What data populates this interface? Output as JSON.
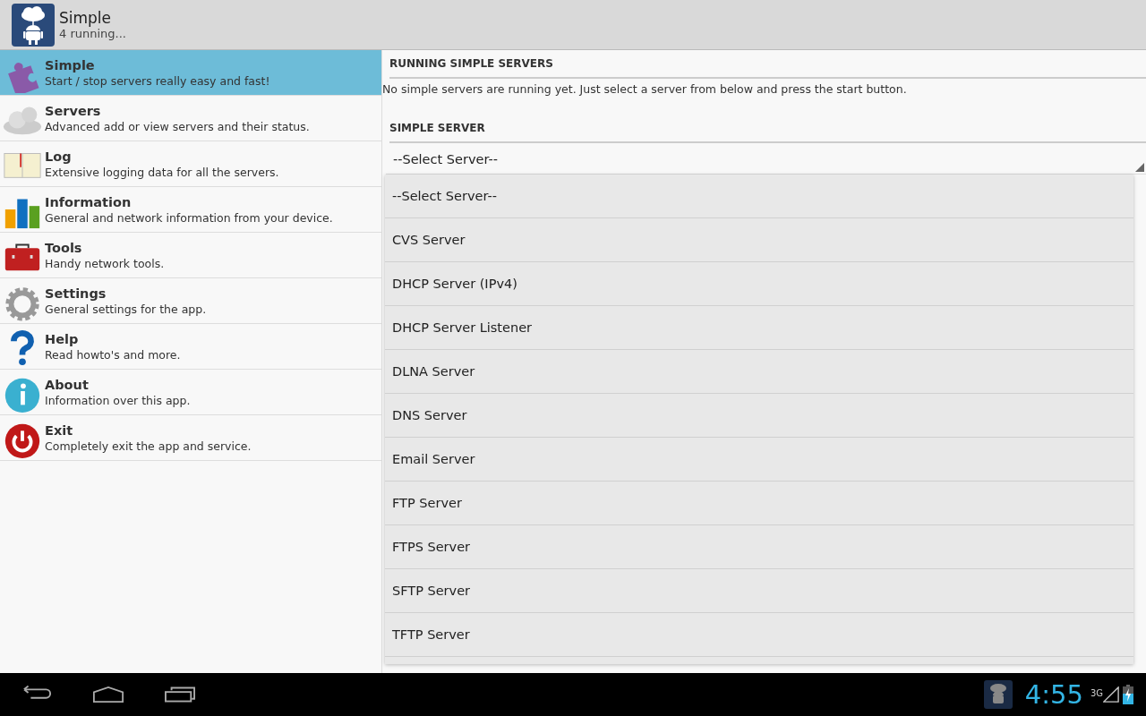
{
  "action_bar": {
    "title": "Simple",
    "subtitle": "4 running..."
  },
  "sidebar": {
    "items": [
      {
        "kind": "puzzle",
        "title": "Simple",
        "subtitle": "Start / stop servers really easy and fast!",
        "selected": true
      },
      {
        "kind": "cloud",
        "title": "Servers",
        "subtitle": "Advanced add or view servers and their status.",
        "selected": false
      },
      {
        "kind": "book",
        "title": "Log",
        "subtitle": "Extensive logging data for all the servers.",
        "selected": false
      },
      {
        "kind": "chart",
        "title": "Information",
        "subtitle": "General and network information from your device.",
        "selected": false
      },
      {
        "kind": "toolbox",
        "title": "Tools",
        "subtitle": "Handy network tools.",
        "selected": false
      },
      {
        "kind": "gear",
        "title": "Settings",
        "subtitle": "General settings for the app.",
        "selected": false
      },
      {
        "kind": "question",
        "title": "Help",
        "subtitle": "Read howto's and more.",
        "selected": false
      },
      {
        "kind": "info",
        "title": "About",
        "subtitle": "Information over this app.",
        "selected": false
      },
      {
        "kind": "power",
        "title": "Exit",
        "subtitle": "Completely exit the app and service.",
        "selected": false
      }
    ]
  },
  "content": {
    "running_header": "RUNNING SIMPLE SERVERS",
    "running_message": "No simple servers are running yet. Just select a server from below and press the start button.",
    "server_header": "SIMPLE SERVER",
    "spinner": {
      "value": "--Select Server--"
    },
    "dropdown_options": [
      "--Select Server--",
      "CVS Server",
      "DHCP Server (IPv4)",
      "DHCP Server Listener",
      "DLNA Server",
      "DNS Server",
      "Email Server",
      "FTP Server",
      "FTPS Server",
      "SFTP Server",
      "TFTP Server"
    ]
  },
  "system_bar": {
    "time": "4:55",
    "network": "3G"
  }
}
